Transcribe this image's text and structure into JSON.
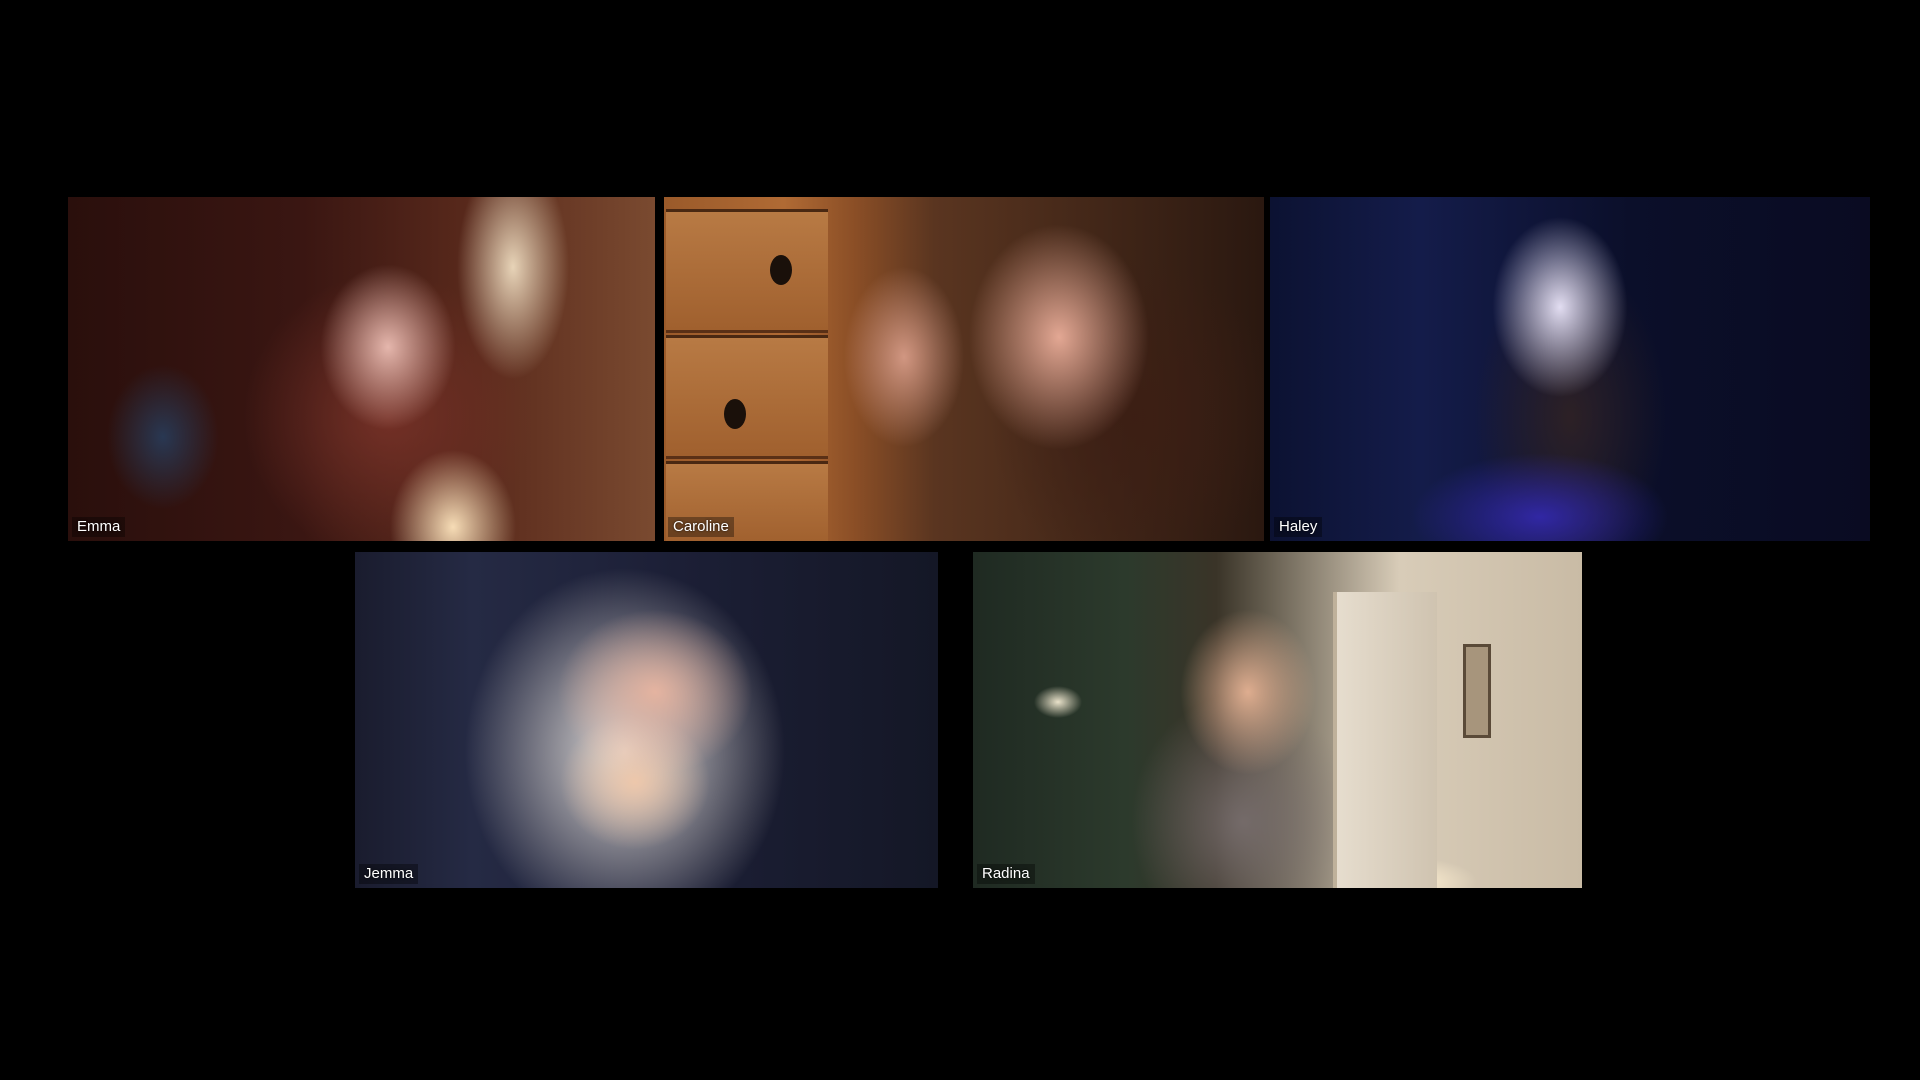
{
  "participants": [
    {
      "id": "emma",
      "name": "Emma"
    },
    {
      "id": "caroline",
      "name": "Caroline"
    },
    {
      "id": "haley",
      "name": "Haley"
    },
    {
      "id": "jemma",
      "name": "Jemma"
    },
    {
      "id": "radina",
      "name": "Radina"
    }
  ]
}
